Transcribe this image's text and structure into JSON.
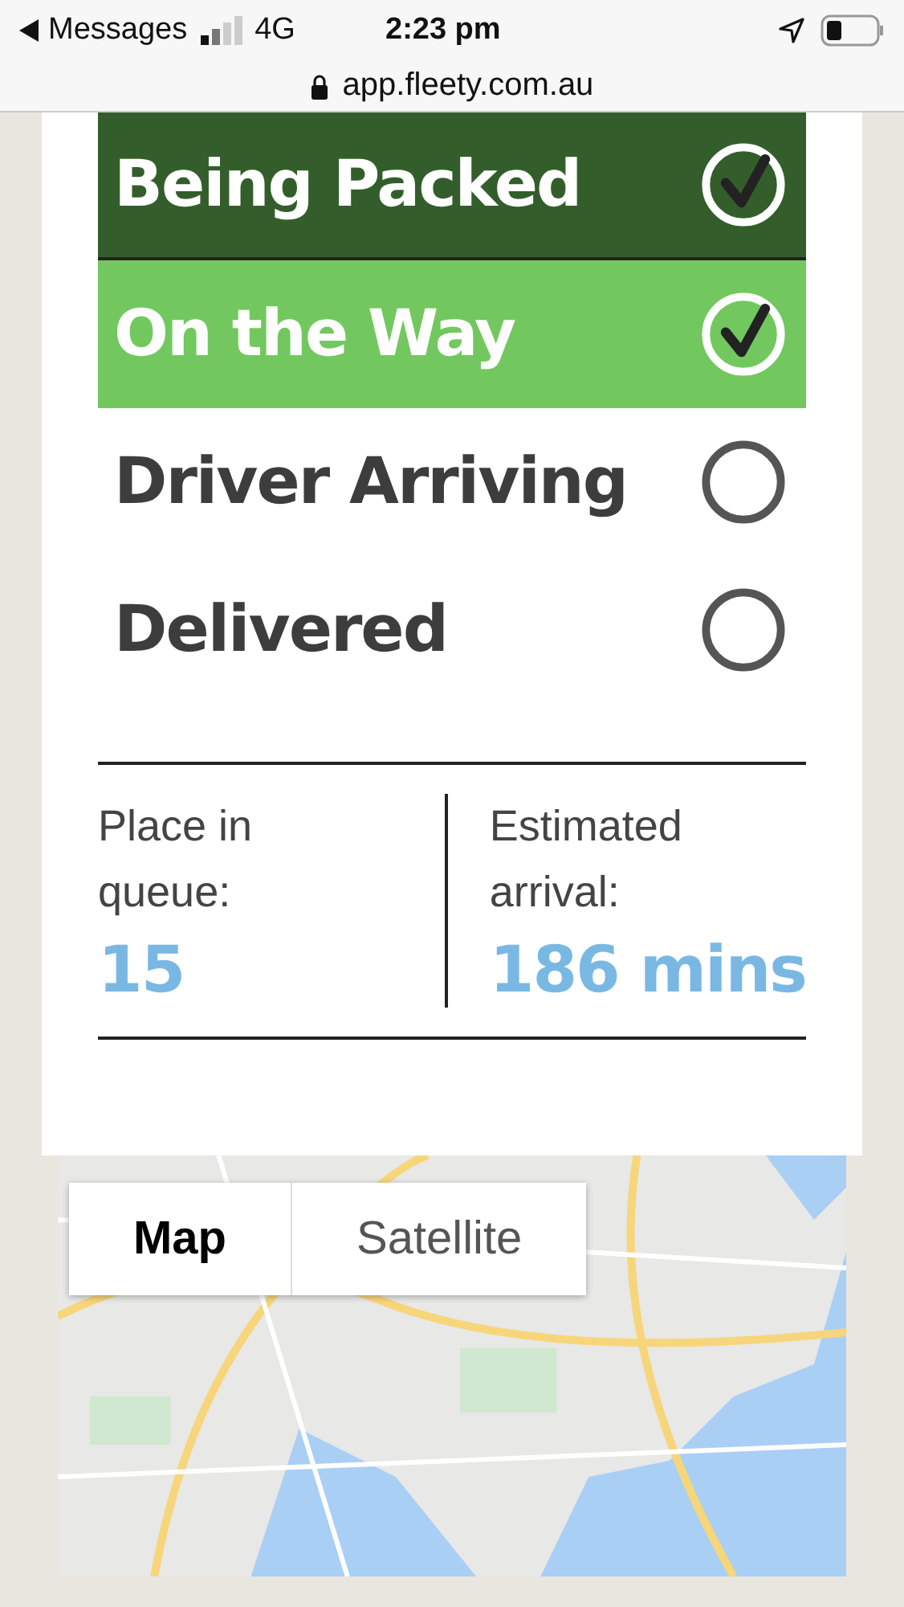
{
  "status_bar": {
    "back_label": "Messages",
    "network": "4G",
    "time": "2:23 pm"
  },
  "address_bar": {
    "url": "app.fleety.com.au"
  },
  "steps": [
    {
      "label": "Being Packed",
      "checked": true,
      "color": "#335e2b"
    },
    {
      "label": "On the Way",
      "checked": true,
      "color": "#72c85f"
    },
    {
      "label": "Driver Arriving",
      "checked": false
    },
    {
      "label": "Delivered",
      "checked": false
    }
  ],
  "stats": [
    {
      "label": "Place in queue:",
      "value": "15"
    },
    {
      "label": "Estimated arrival:",
      "value": "186 mins"
    }
  ],
  "map": {
    "kind": "picture",
    "tabs": [
      {
        "label": "Map",
        "selected": true
      },
      {
        "label": "Satellite",
        "selected": false
      }
    ]
  }
}
